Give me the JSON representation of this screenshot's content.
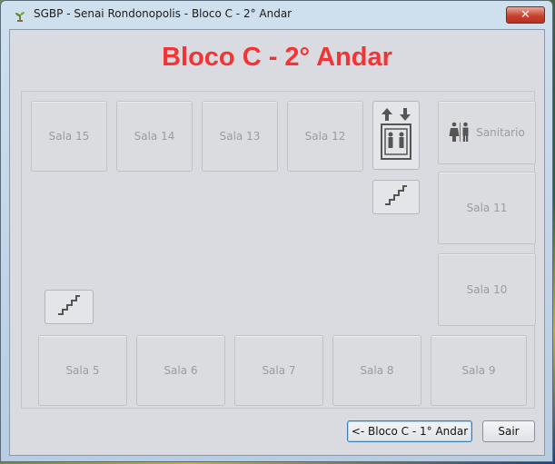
{
  "window": {
    "title": "SGBP - Senai Rondonopolis - Bloco C - 2° Andar",
    "close_label": "✕"
  },
  "heading": "Bloco C - 2° Andar",
  "rooms": {
    "sala15": "Sala 15",
    "sala14": "Sala 14",
    "sala13": "Sala 13",
    "sala12": "Sala 12",
    "sala11": "Sala 11",
    "sala10": "Sala 10",
    "sala5": "Sala 5",
    "sala6": "Sala 6",
    "sala7": "Sala 7",
    "sala8": "Sala 8",
    "sala9": "Sala 9",
    "sanitario": "Sanitario"
  },
  "icons": {
    "app": "plant-icon",
    "elevator": "elevator-icon",
    "stairs": "stairs-icon",
    "restroom": "restroom-icon"
  },
  "buttons": {
    "previous": "<- Bloco C - 1° Andar",
    "exit": "Sair"
  },
  "colors": {
    "heading": "#f23434",
    "disabled_text": "#9a9ca0"
  }
}
